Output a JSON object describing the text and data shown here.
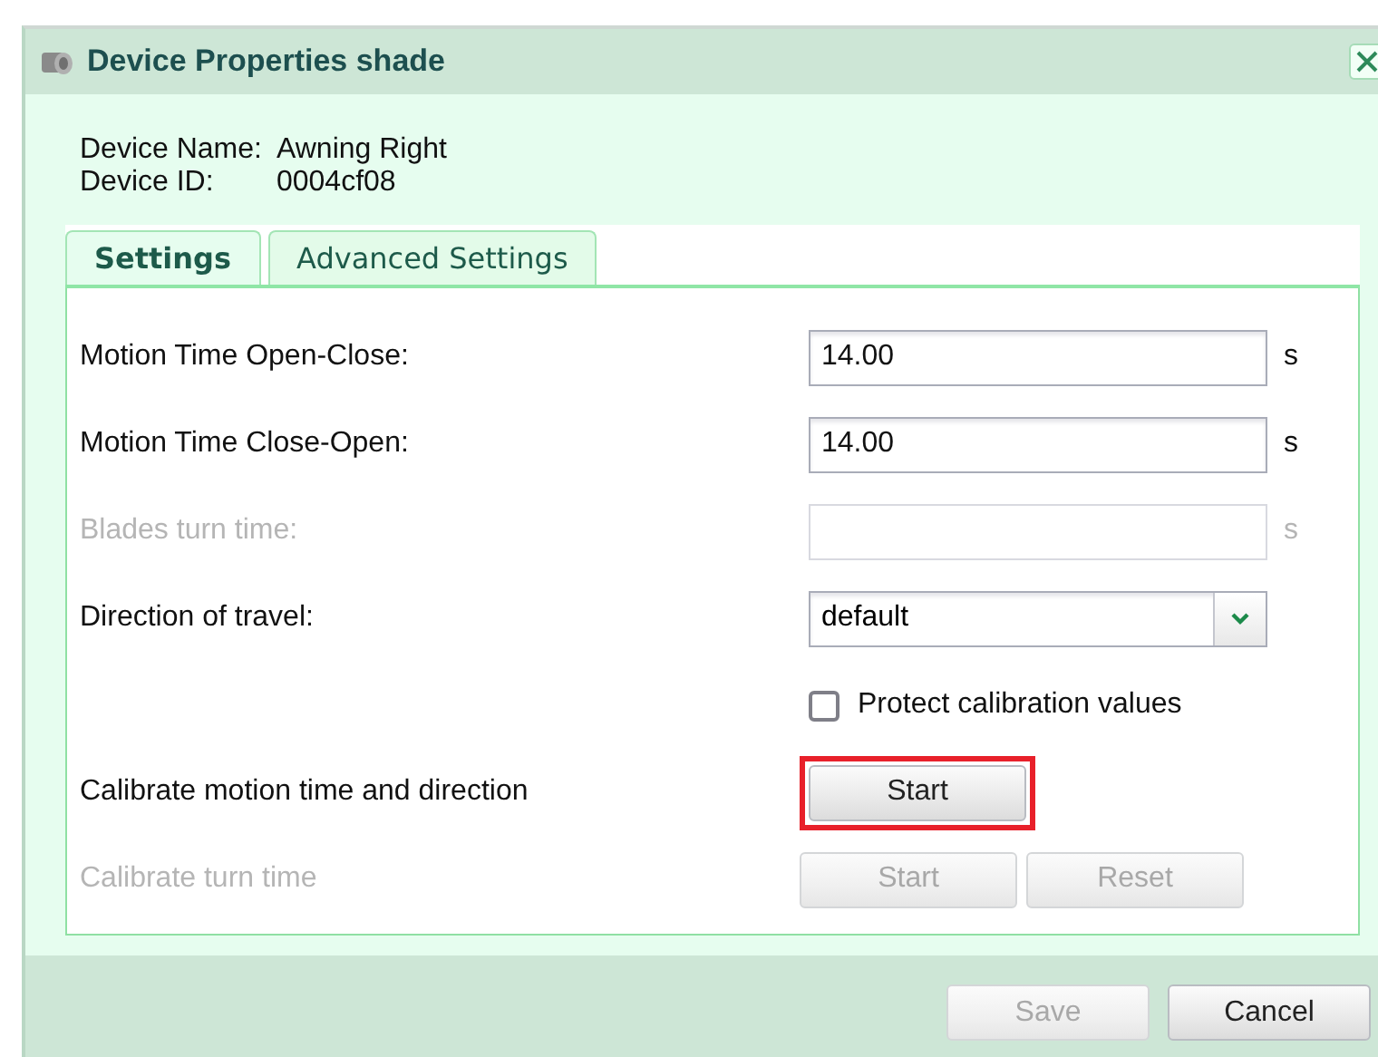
{
  "window": {
    "title": "Device Properties shade"
  },
  "device": [
    {
      "label": "Device Name:",
      "value": "Awning Right"
    },
    {
      "label": "Device ID:",
      "value": "0004cf08"
    }
  ],
  "tabs": [
    {
      "label": "Settings",
      "selected": true
    },
    {
      "label": "Advanced Settings",
      "selected": false
    }
  ],
  "rows": [
    {
      "kind": "input",
      "label": "Motion Time Open-Close:",
      "value": "14.00",
      "unit": "s",
      "disabled": false
    },
    {
      "kind": "input",
      "label": "Motion Time Close-Open:",
      "value": "14.00",
      "unit": "s",
      "disabled": false
    },
    {
      "kind": "input",
      "label": "Blades turn time:",
      "unit": "s",
      "disabled": true
    },
    {
      "kind": "select",
      "label": "Direction of travel:",
      "value": "default",
      "disabled": false
    },
    {
      "kind": "checkbox",
      "label": "Protect calibration values",
      "checked": false
    },
    {
      "kind": "buttons",
      "label": "Calibrate motion time and direction",
      "disabled": false,
      "buttons": [
        {
          "label": "Start",
          "disabled": false,
          "highlighted": true
        }
      ]
    },
    {
      "kind": "buttons",
      "label": "Calibrate turn time",
      "disabled": true,
      "buttons": [
        {
          "label": "Start",
          "disabled": true
        },
        {
          "label": "Reset",
          "disabled": true
        }
      ]
    }
  ],
  "footer_buttons": [
    {
      "label": "Save",
      "disabled": true
    },
    {
      "label": "Cancel",
      "disabled": false
    }
  ]
}
